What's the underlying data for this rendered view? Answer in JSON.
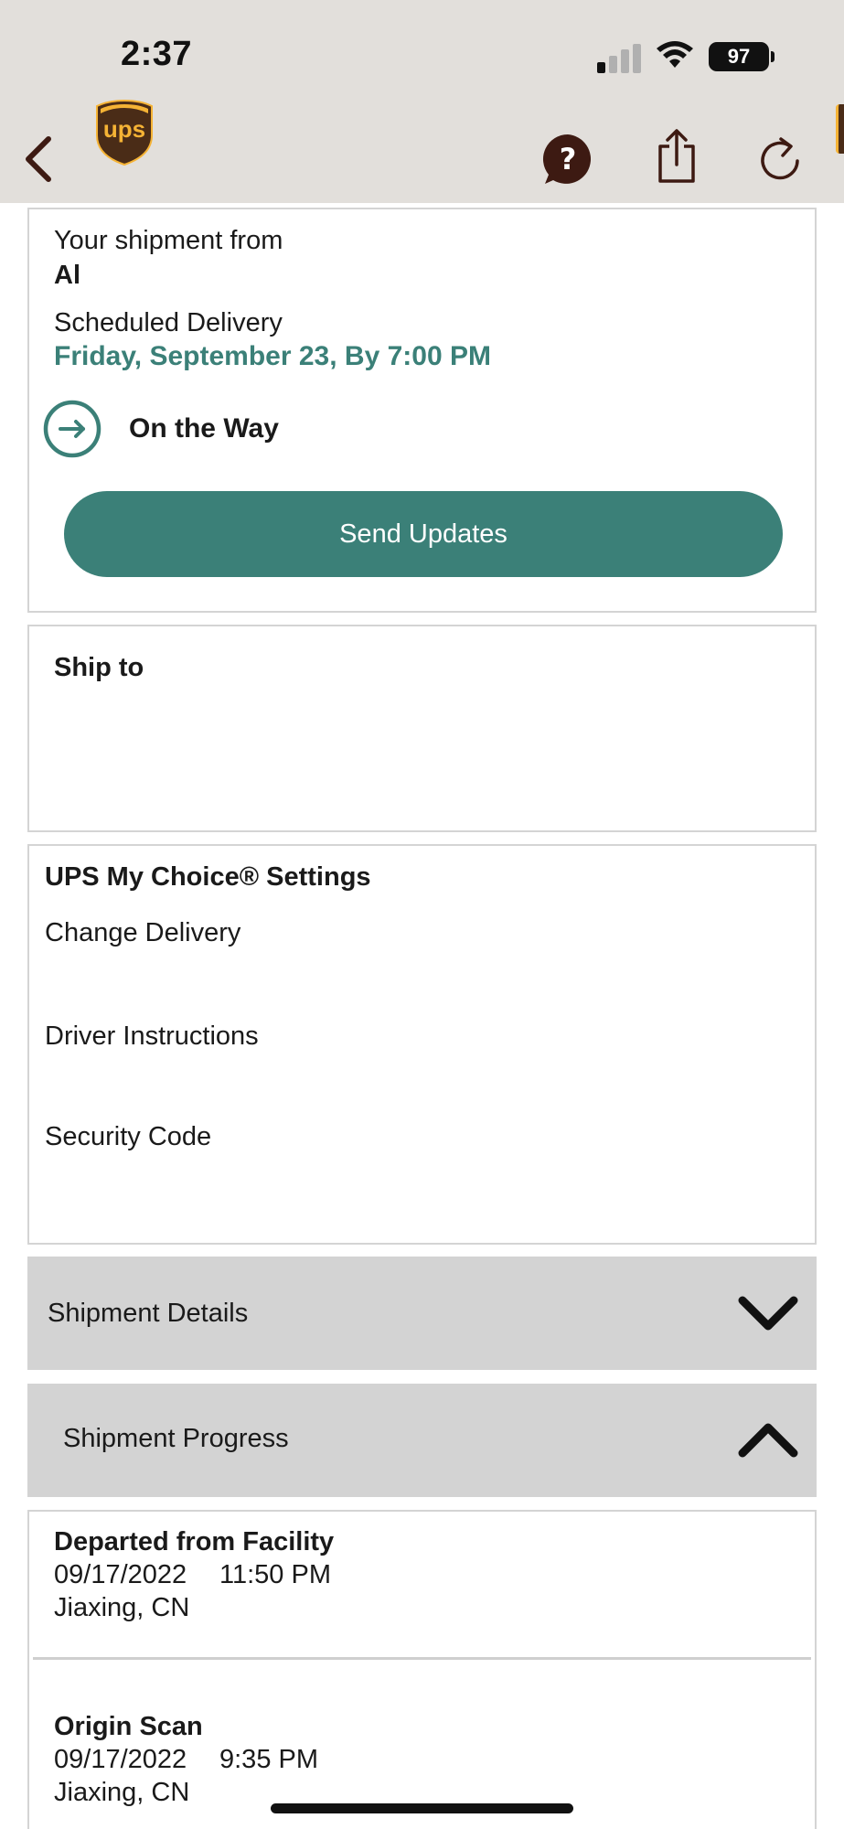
{
  "status_bar": {
    "time": "2:37",
    "battery": "97"
  },
  "nav": {
    "back_icon": "chevron-left-icon",
    "help_icon": "help-chat-icon",
    "share_icon": "share-icon",
    "refresh_icon": "refresh-icon",
    "logo": "ups-shield-logo",
    "logo_text": "ups"
  },
  "shipment_summary": {
    "from_label": "Your shipment from",
    "from_value": "Al",
    "scheduled_label": "Scheduled Delivery",
    "scheduled_value": "Friday, September 23, By 7:00 PM",
    "status_text": "On the Way",
    "status_icon": "arrow-right-circle-icon",
    "send_updates_label": "Send Updates"
  },
  "ship_to": {
    "title": "Ship to"
  },
  "my_choice": {
    "title": "UPS My Choice® Settings",
    "items": [
      "Change Delivery",
      "Driver Instructions",
      "Security Code"
    ]
  },
  "sections": {
    "details_label": "Shipment Details",
    "details_icon": "chevron-down-icon",
    "progress_label": "Shipment Progress",
    "progress_icon": "chevron-up-icon"
  },
  "progress_events": [
    {
      "title": "Departed from Facility",
      "date": "09/17/2022",
      "time": "11:50 PM",
      "location": "Jiaxing, CN"
    },
    {
      "title": "Origin Scan",
      "date": "09/17/2022",
      "time": "9:35 PM",
      "location": "Jiaxing, CN"
    }
  ],
  "colors": {
    "accent": "#3b8078",
    "header_bg": "#e2dfdb",
    "nav_icon": "#3d1a12",
    "logo_brown": "#4a2c17",
    "logo_gold": "#f5b335",
    "accordion_bg": "#d3d3d3"
  }
}
